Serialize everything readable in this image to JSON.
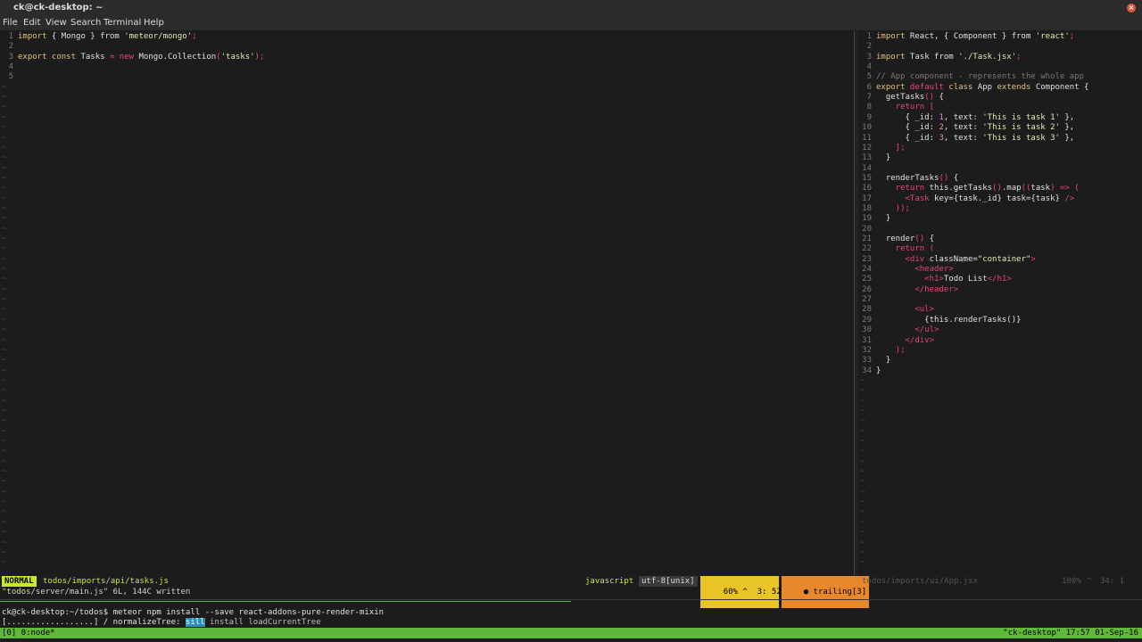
{
  "window": {
    "title": "ck@ck-desktop: ~"
  },
  "menu": [
    "File",
    "Edit",
    "View",
    "Search",
    "Terminal",
    "Help"
  ],
  "left_editor": {
    "lines": [
      {
        "n": "1",
        "segs": [
          [
            "kw",
            "import"
          ],
          [
            "plain",
            " { Mongo } "
          ],
          [
            "plain",
            "from "
          ],
          [
            "str",
            "'meteor/mongo'"
          ],
          [
            "pink",
            ";"
          ]
        ]
      },
      {
        "n": "2",
        "segs": []
      },
      {
        "n": "3",
        "segs": [
          [
            "kw",
            "export const"
          ],
          [
            "plain",
            " Tasks "
          ],
          [
            "pink",
            "= new"
          ],
          [
            "plain",
            " Mongo.Collection"
          ],
          [
            "pink",
            "("
          ],
          [
            "str",
            "'tasks'"
          ],
          [
            "pink",
            ");"
          ]
        ]
      },
      {
        "n": "4",
        "segs": []
      },
      {
        "n": "5",
        "segs": []
      }
    ]
  },
  "right_editor": {
    "lines": [
      {
        "n": "1",
        "segs": [
          [
            "kw",
            "import"
          ],
          [
            "plain",
            " React, { Component } from "
          ],
          [
            "str",
            "'react'"
          ],
          [
            "pink",
            ";"
          ]
        ]
      },
      {
        "n": "2",
        "segs": []
      },
      {
        "n": "3",
        "segs": [
          [
            "kw",
            "import"
          ],
          [
            "plain",
            " Task from "
          ],
          [
            "str",
            "'./Task.jsx'"
          ],
          [
            "pink",
            ";"
          ]
        ]
      },
      {
        "n": "4",
        "segs": []
      },
      {
        "n": "5",
        "segs": [
          [
            "cm",
            "// App component - represents the whole app"
          ]
        ]
      },
      {
        "n": "6",
        "segs": [
          [
            "kw",
            "export"
          ],
          [
            "pink",
            " default "
          ],
          [
            "kw",
            "class"
          ],
          [
            "plain",
            " App "
          ],
          [
            "kw",
            "extends"
          ],
          [
            "plain",
            " Component {"
          ]
        ]
      },
      {
        "n": "7",
        "segs": [
          [
            "plain",
            "  getTasks"
          ],
          [
            "pink",
            "()"
          ],
          [
            "plain",
            " {"
          ]
        ]
      },
      {
        "n": "8",
        "segs": [
          [
            "pink",
            "    return ["
          ]
        ]
      },
      {
        "n": "9",
        "segs": [
          [
            "plain",
            "      { _id: "
          ],
          [
            "num",
            "1"
          ],
          [
            "plain",
            ", text: "
          ],
          [
            "str",
            "'This is task 1'"
          ],
          [
            "plain",
            " },"
          ]
        ]
      },
      {
        "n": "10",
        "segs": [
          [
            "plain",
            "      { _id: "
          ],
          [
            "num",
            "2"
          ],
          [
            "plain",
            ", text: "
          ],
          [
            "str",
            "'This is task 2'"
          ],
          [
            "plain",
            " },"
          ]
        ]
      },
      {
        "n": "11",
        "segs": [
          [
            "plain",
            "      { _id: "
          ],
          [
            "num",
            "3"
          ],
          [
            "plain",
            ", text: "
          ],
          [
            "str",
            "'This is task 3'"
          ],
          [
            "plain",
            " },"
          ]
        ]
      },
      {
        "n": "12",
        "segs": [
          [
            "pink",
            "    ];"
          ]
        ]
      },
      {
        "n": "13",
        "segs": [
          [
            "plain",
            "  }"
          ]
        ]
      },
      {
        "n": "14",
        "segs": []
      },
      {
        "n": "15",
        "segs": [
          [
            "plain",
            "  renderTasks"
          ],
          [
            "pink",
            "()"
          ],
          [
            "plain",
            " {"
          ]
        ]
      },
      {
        "n": "16",
        "segs": [
          [
            "pink",
            "    return"
          ],
          [
            "plain",
            " this.getTasks"
          ],
          [
            "pink",
            "()"
          ],
          [
            "plain",
            ".map"
          ],
          [
            "pink",
            "(("
          ],
          [
            "plain",
            "task"
          ],
          [
            "pink",
            ") => ("
          ]
        ]
      },
      {
        "n": "17",
        "segs": [
          [
            "tag",
            "      <Task"
          ],
          [
            "plain",
            " key={task._id} task={task} "
          ],
          [
            "tag",
            "/>"
          ]
        ]
      },
      {
        "n": "18",
        "segs": [
          [
            "pink",
            "    ));"
          ]
        ]
      },
      {
        "n": "19",
        "segs": [
          [
            "plain",
            "  }"
          ]
        ]
      },
      {
        "n": "20",
        "segs": []
      },
      {
        "n": "21",
        "segs": [
          [
            "plain",
            "  render"
          ],
          [
            "pink",
            "()"
          ],
          [
            "plain",
            " {"
          ]
        ]
      },
      {
        "n": "22",
        "segs": [
          [
            "pink",
            "    return ("
          ]
        ]
      },
      {
        "n": "23",
        "segs": [
          [
            "tag",
            "      <div"
          ],
          [
            "plain",
            " className="
          ],
          [
            "str",
            "\"container\""
          ],
          [
            "tag",
            ">"
          ]
        ]
      },
      {
        "n": "24",
        "segs": [
          [
            "tag",
            "        <header>"
          ]
        ]
      },
      {
        "n": "25",
        "segs": [
          [
            "tag",
            "          <h1>"
          ],
          [
            "plain",
            "Todo List"
          ],
          [
            "tag",
            "</h1>"
          ]
        ]
      },
      {
        "n": "26",
        "segs": [
          [
            "tag",
            "        </header>"
          ]
        ]
      },
      {
        "n": "27",
        "segs": []
      },
      {
        "n": "28",
        "segs": [
          [
            "tag",
            "        <ul>"
          ]
        ]
      },
      {
        "n": "29",
        "segs": [
          [
            "plain",
            "          {this.renderTasks()}"
          ]
        ]
      },
      {
        "n": "30",
        "segs": [
          [
            "tag",
            "        </ul>"
          ]
        ]
      },
      {
        "n": "31",
        "segs": [
          [
            "tag",
            "      </div>"
          ]
        ]
      },
      {
        "n": "32",
        "segs": [
          [
            "pink",
            "    );"
          ]
        ]
      },
      {
        "n": "33",
        "segs": [
          [
            "plain",
            "  }"
          ]
        ]
      },
      {
        "n": "34",
        "segs": [
          [
            "plain",
            "}"
          ]
        ]
      }
    ]
  },
  "status": {
    "mode": "NORMAL",
    "file": "todos/imports/api/tasks.js",
    "filetype": "javascript",
    "encoding": "utf-8[unix]",
    "percent": "60%",
    "position": "3: 52",
    "trailing": "trailing[3]",
    "inactive_file": "todos/imports/ui/App.jsx",
    "inactive_percent": "100%",
    "inactive_position": "34: 1"
  },
  "cmdline": "\"todos/server/main.js\" 6L, 144C written",
  "terminal": {
    "prompt_line": "ck@ck-desktop:~/todos$ meteor npm install --save react-addons-pure-render-mixin",
    "progress_line": "[..................] / normalizeTree: ",
    "progress_highlight": "sill",
    "progress_tail": " install loadCurrentTree"
  },
  "tmux": {
    "window": "[0] 0:node*",
    "host": "\"ck-desktop\" 17:57 01-Sep-16"
  }
}
